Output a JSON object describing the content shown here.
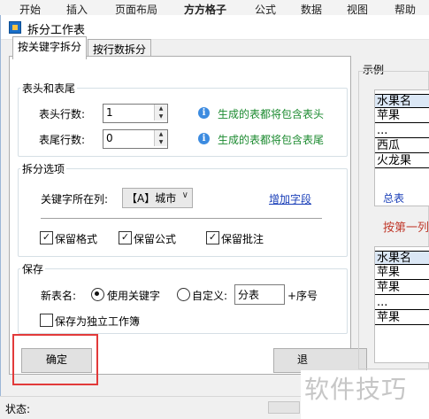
{
  "ribbon": {
    "tabs": [
      "开始",
      "插入",
      "页面布局",
      "方方格子",
      "公式",
      "数据",
      "视图",
      "帮助"
    ]
  },
  "dialog": {
    "title": "拆分工作表",
    "tabs": [
      "按关键字拆分",
      "按行数拆分"
    ],
    "header_footer": {
      "legend": "表头和表尾",
      "header_rows_label": "表头行数:",
      "header_rows_value": "1",
      "header_hint": "生成的表都将包含表头",
      "footer_rows_label": "表尾行数:",
      "footer_rows_value": "0",
      "footer_hint": "生成的表都将包含表尾"
    },
    "split_options": {
      "legend": "拆分选项",
      "key_column_label": "关键字所在列:",
      "key_column_value": "【A】城市",
      "add_field_link": "增加字段",
      "keep_format": "保留格式",
      "keep_formula": "保留公式",
      "keep_comment": "保留批注",
      "keep_format_checked": true,
      "keep_formula_checked": true,
      "keep_comment_checked": true
    },
    "save": {
      "legend": "保存",
      "new_sheet_name_label": "新表名:",
      "use_keyword_label": "使用关键字",
      "custom_label": "自定义:",
      "custom_value": "分表",
      "suffix_label": "+序号",
      "save_as_workbook_label": "保存为独立工作簿",
      "use_keyword_selected": true
    },
    "ok_button": "确定",
    "cancel_button_partial": "退",
    "status_label": "状态:",
    "example": {
      "label": "示例",
      "sheet1_rows": [
        "水果名",
        "苹果",
        "...",
        "西瓜",
        "火龙果"
      ],
      "sheet1_tab": "总表",
      "by_column_text": "按第一列",
      "sheet2_rows": [
        "水果名",
        "苹果",
        "苹果",
        "...",
        "苹果"
      ]
    }
  },
  "watermark": "软件技巧"
}
